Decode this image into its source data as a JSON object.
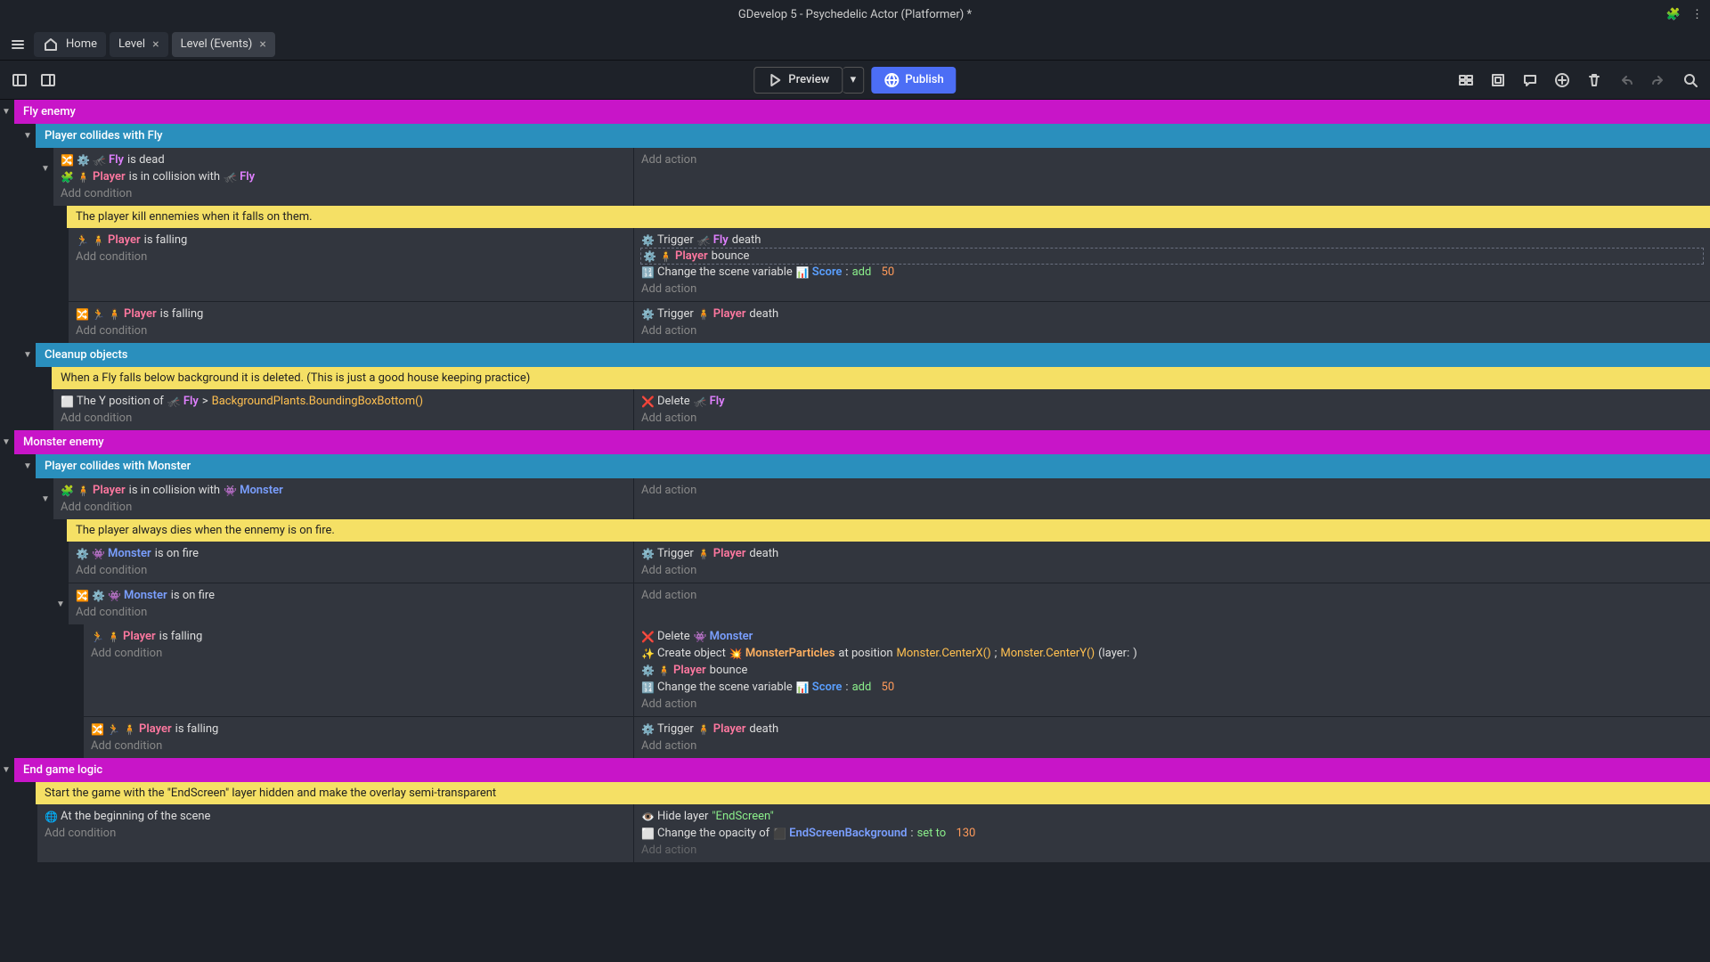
{
  "title": "GDevelop 5 - Psychedelic Actor (Platformer) *",
  "tabs": {
    "home": "Home",
    "level": "Level",
    "events": "Level (Events)"
  },
  "toolbar": {
    "preview": "Preview",
    "publish": "Publish"
  },
  "txt": {
    "addCond": "Add condition",
    "addAct": "Add action",
    "flyEnemy": "Fly enemy",
    "playerFly": "Player collides with Fly",
    "flyDead": " is dead",
    "collisionWith": " is in collision with ",
    "commentKill": "The player kill ennemies when it falls on them.",
    "isFalling": " is falling",
    "trigger": "Trigger ",
    "death": " death",
    "bounce": " bounce",
    "changeVar": "Change the scene variable ",
    "add": "add",
    "fifty": "50",
    "cleanup": "Cleanup objects",
    "commentCleanup": "When a Fly falls below background it is deleted. (This is just a good house keeping practice)",
    "yPos": "The Y position of ",
    "gt": " > ",
    "bgExpr": "BackgroundPlants.BoundingBoxBottom()",
    "delete": "Delete ",
    "monsterEnemy": "Monster enemy",
    "playerMonster": "Player collides with Monster",
    "commentFire": "The player always dies when the ennemy is on fire.",
    "onFire": " is on fire",
    "createObj": "Create object ",
    "atPos": " at position ",
    "mposX": "Monster.CenterX()",
    "mposY": "Monster.CenterY()",
    "layer": " (layer: ",
    "rparen": ")",
    "semi": ";",
    "endGame": "End game logic",
    "commentEnd": "Start the game with the \"EndScreen\" layer hidden and make the overlay semi-transparent",
    "atBegin": "At the beginning of the scene",
    "hideLayer": "Hide layer ",
    "endScreen": "\"EndScreen\"",
    "changeOpacity": "Change the opacity of ",
    "setTo": "set to",
    "v130": "130",
    "colon": ": ",
    "inv": "",
    "fly": "Fly",
    "player": "Player",
    "monster": "Monster",
    "monsterParticles": "MonsterParticles",
    "score": "Score",
    "endBg": "EndScreenBackground"
  }
}
